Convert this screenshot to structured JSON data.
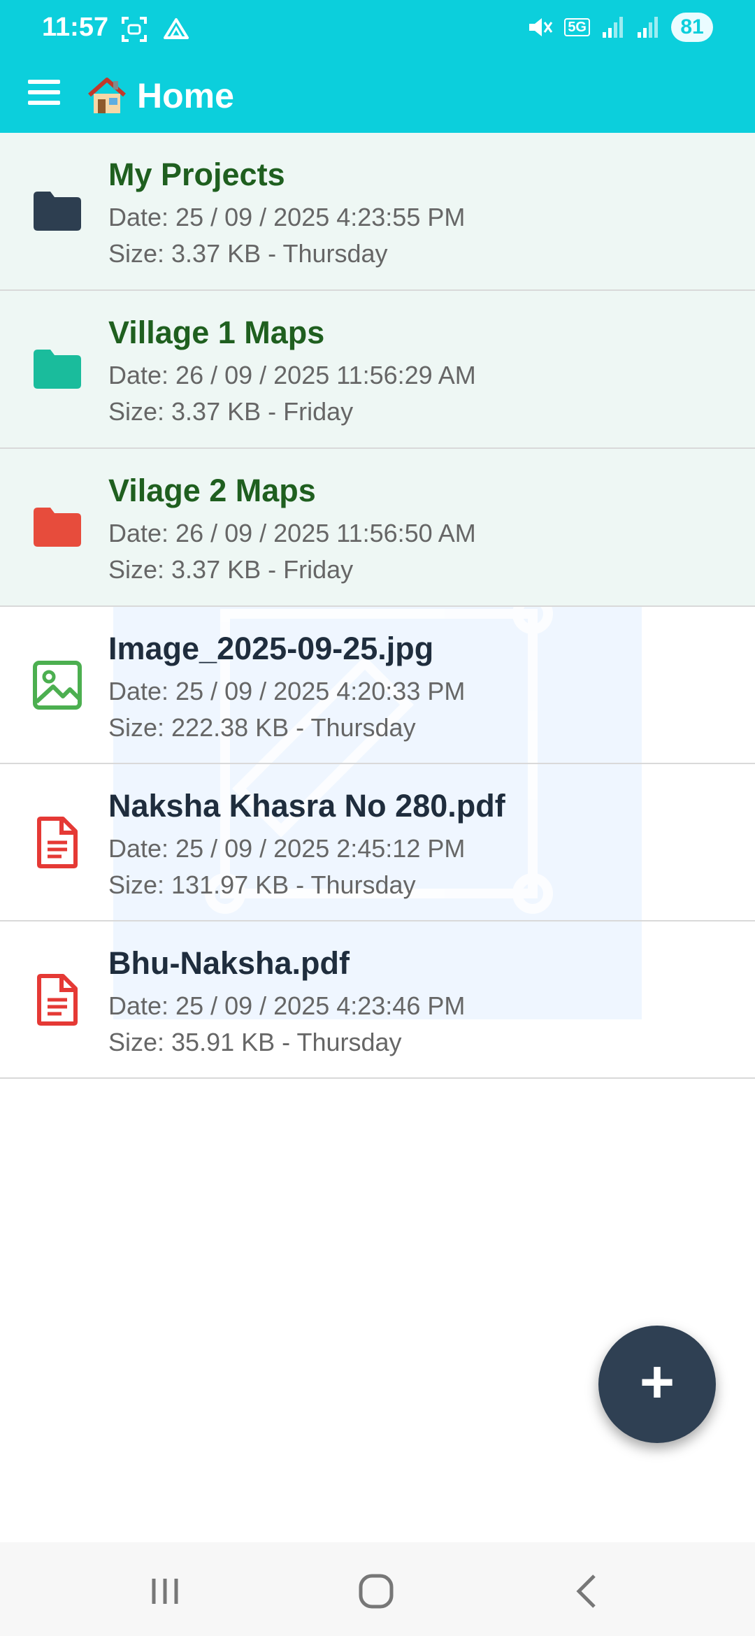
{
  "status_bar": {
    "time": "11:57",
    "network": "5G",
    "battery": "81"
  },
  "app_bar": {
    "title": "Home",
    "title_icon": "house-emoji-icon",
    "menu_icon": "hamburger-menu-icon"
  },
  "colors": {
    "app_bar": "#0ccfdc",
    "folder_row_bg": "#eef7f4",
    "folder_name": "#1f5f1f",
    "file_name": "#1f2d3d",
    "fab_bg": "#2f4053",
    "folder_dark": "#2d3e50",
    "folder_teal": "#1abc9c",
    "folder_red": "#e74c3c",
    "image_green": "#4caf50",
    "pdf_red": "#e53935"
  },
  "items": [
    {
      "kind": "folder",
      "icon": "folder-icon",
      "color": "#2d3e50",
      "name": "My Projects",
      "date": "Date: 25 / 09 / 2025 4:23:55 PM",
      "size": "Size: 3.37 KB - Thursday"
    },
    {
      "kind": "folder",
      "icon": "folder-icon",
      "color": "#1abc9c",
      "name": "Village 1 Maps",
      "date": "Date: 26 / 09 / 2025 11:56:29 AM",
      "size": "Size: 3.37 KB - Friday"
    },
    {
      "kind": "folder",
      "icon": "folder-icon",
      "color": "#e74c3c",
      "name": "Vilage 2 Maps",
      "date": "Date: 26 / 09 / 2025 11:56:50 AM",
      "size": "Size: 3.37 KB - Friday"
    },
    {
      "kind": "image",
      "icon": "image-file-icon",
      "color": "#4caf50",
      "name": "Image_2025-09-25.jpg",
      "date": "Date: 25 / 09 / 2025 4:20:33 PM",
      "size": "Size: 222.38 KB - Thursday"
    },
    {
      "kind": "pdf",
      "icon": "pdf-file-icon",
      "color": "#e53935",
      "name": "Naksha Khasra No 280.pdf",
      "date": "Date: 25 / 09 / 2025 2:45:12 PM",
      "size": "Size: 131.97 KB - Thursday"
    },
    {
      "kind": "pdf",
      "icon": "pdf-file-icon",
      "color": "#e53935",
      "name": "Bhu-Naksha.pdf",
      "date": "Date: 25 / 09 / 2025 4:23:46 PM",
      "size": "Size: 35.91 KB - Thursday"
    }
  ],
  "fab": {
    "label": "+",
    "icon": "plus-icon"
  },
  "nav_bar": {
    "recent_icon": "recent-apps-icon",
    "home_icon": "home-circle-icon",
    "back_icon": "back-chevron-icon"
  }
}
